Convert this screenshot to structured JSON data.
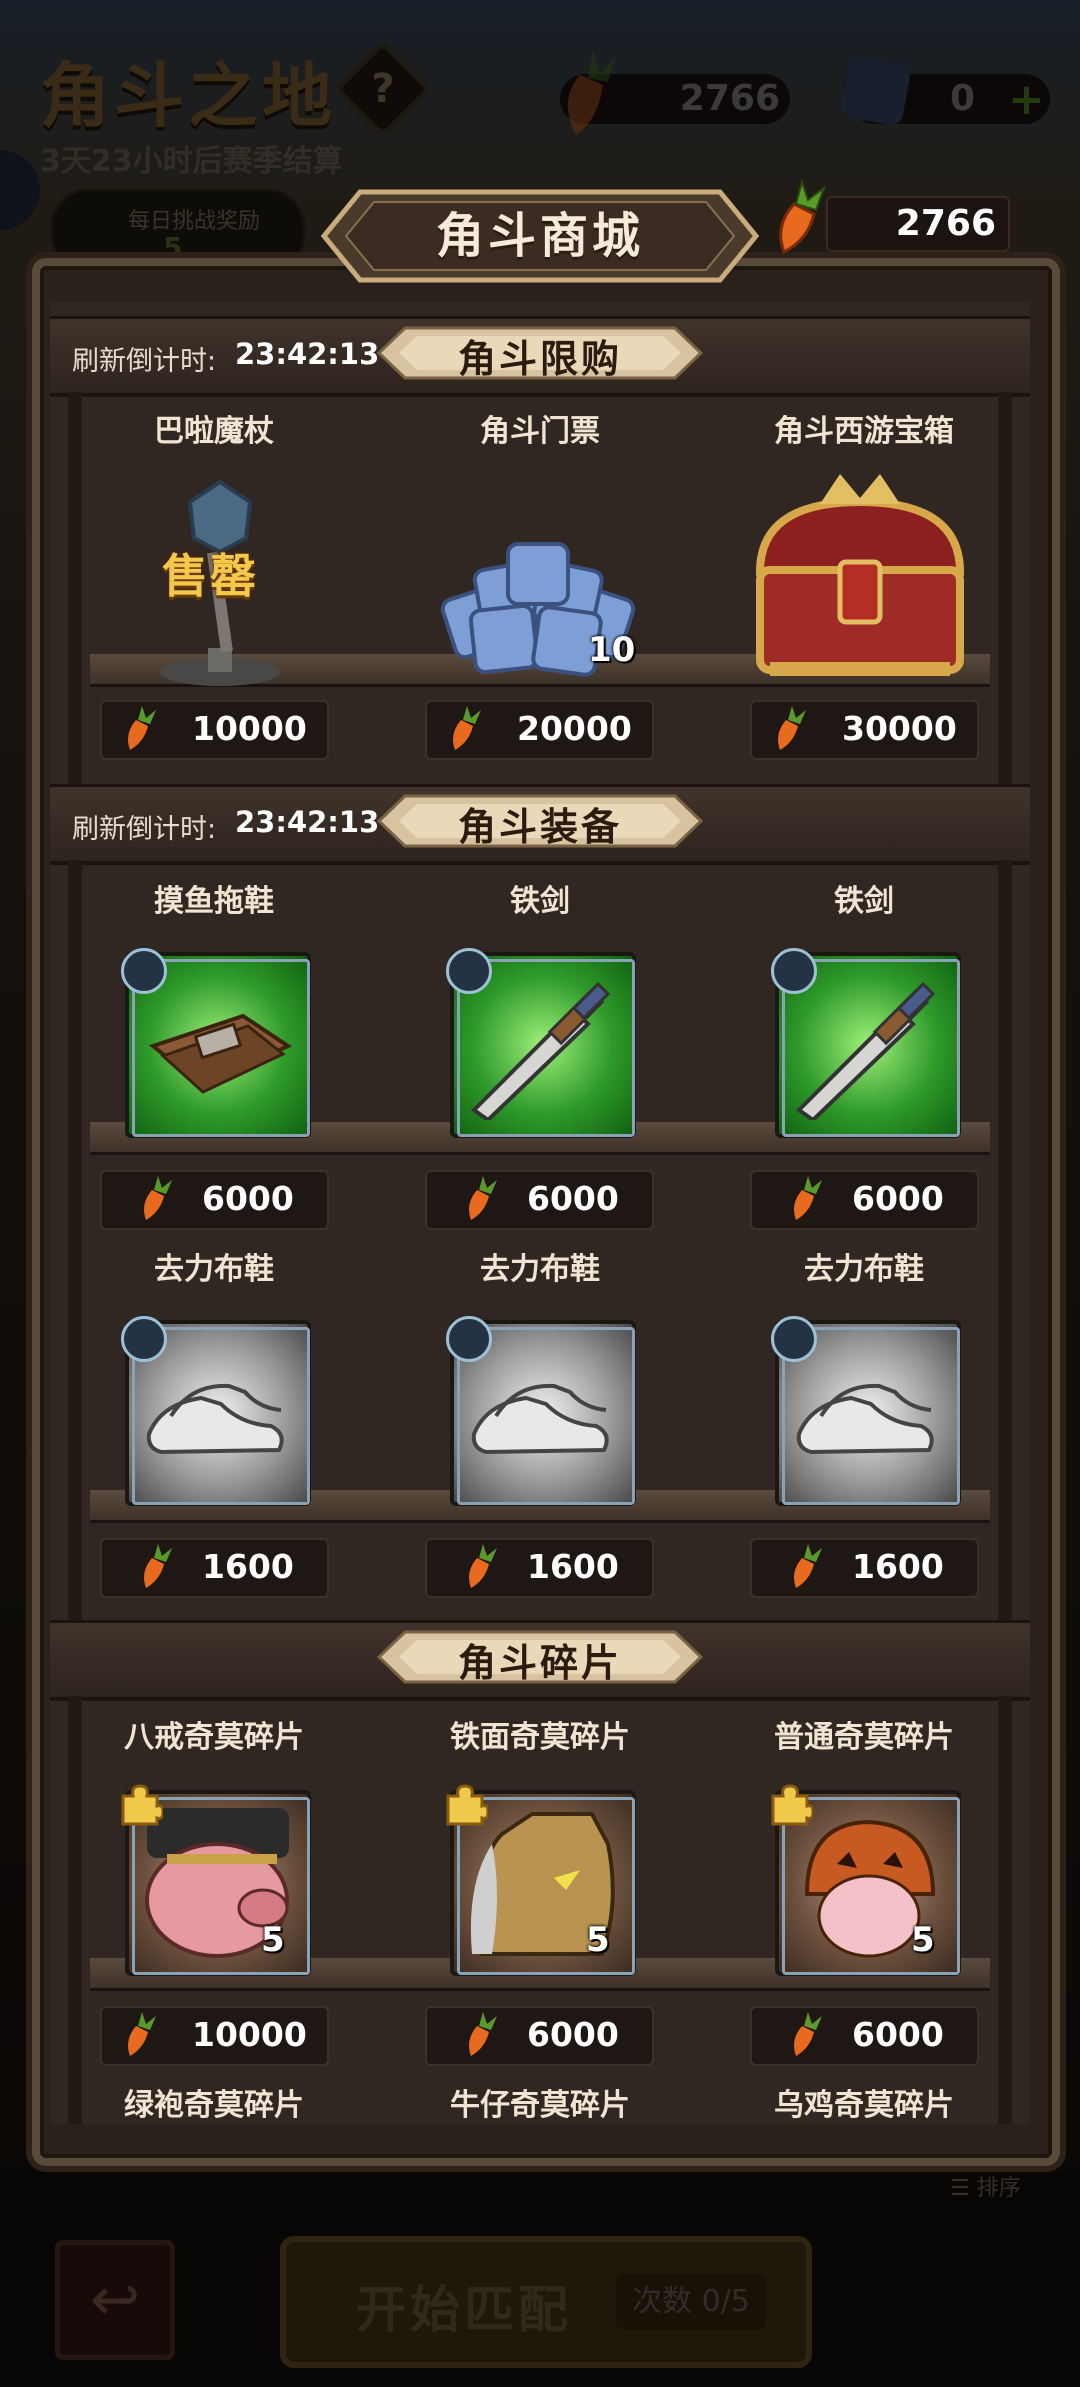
{
  "background": {
    "arena_title": "角斗之地",
    "help": "?",
    "season_text": "3天23小时后赛季结算",
    "daily_reward_label": "每日挑战奖励",
    "daily_reward_count": "5",
    "carrot_balance": "2766",
    "ticket_balance": "0",
    "start_match_label": "开始匹配",
    "match_count_label": "次数 0/5",
    "sort_label": "排序",
    "back_icon": "back-arrow-icon"
  },
  "shop": {
    "title": "角斗商城",
    "carrot_currency": "2766",
    "sections": [
      {
        "title": "角斗限购",
        "timer_label": "刷新倒计时:",
        "timer_value": "23:42:13",
        "items": [
          {
            "name": "巴啦魔杖",
            "price": "10000",
            "sold_out_label": "售罄",
            "icon": "magic-staff-icon"
          },
          {
            "name": "角斗门票",
            "price": "20000",
            "count": "10",
            "icon": "ticket-pile-icon"
          },
          {
            "name": "角斗西游宝箱",
            "price": "30000",
            "icon": "treasure-chest-icon"
          }
        ]
      },
      {
        "title": "角斗装备",
        "timer_label": "刷新倒计时:",
        "timer_value": "23:42:13",
        "items": [
          {
            "name": "摸鱼拖鞋",
            "price": "6000",
            "icon": "slippers-icon",
            "rarity": "green"
          },
          {
            "name": "铁剑",
            "price": "6000",
            "icon": "sword-icon",
            "rarity": "green"
          },
          {
            "name": "铁剑",
            "price": "6000",
            "icon": "sword-icon",
            "rarity": "green"
          },
          {
            "name": "去力布鞋",
            "price": "1600",
            "icon": "cloth-shoes-icon",
            "rarity": "gray"
          },
          {
            "name": "去力布鞋",
            "price": "1600",
            "icon": "cloth-shoes-icon",
            "rarity": "gray"
          },
          {
            "name": "去力布鞋",
            "price": "1600",
            "icon": "cloth-shoes-icon",
            "rarity": "gray"
          }
        ]
      },
      {
        "title": "角斗碎片",
        "items": [
          {
            "name": "八戒奇莫碎片",
            "price": "10000",
            "count": "5",
            "icon": "pig-hero-portrait-icon"
          },
          {
            "name": "铁面奇莫碎片",
            "price": "6000",
            "count": "5",
            "icon": "iron-mask-hero-portrait-icon"
          },
          {
            "name": "普通奇莫碎片",
            "price": "6000",
            "count": "5",
            "icon": "pumpkin-hero-portrait-icon"
          },
          {
            "name": "绿袍奇莫碎片"
          },
          {
            "name": "牛仔奇莫碎片"
          },
          {
            "name": "乌鸡奇莫碎片"
          }
        ]
      }
    ]
  },
  "colors": {
    "panel_bg": "#302722",
    "gold_text": "#f4c84a",
    "rarity_green": "#2f9a2a",
    "rarity_gray": "#9a9a9a",
    "carrot_orange": "#e86a1e"
  }
}
